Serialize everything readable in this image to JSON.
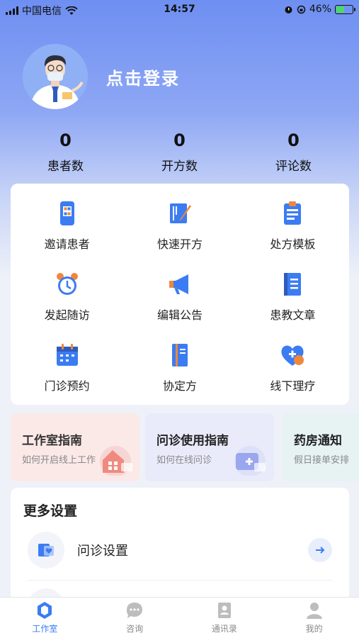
{
  "status": {
    "carrier": "中国电信",
    "time": "14:57",
    "battery": "46%",
    "battery_level": 0.46
  },
  "profile": {
    "login_text": "点击登录"
  },
  "stats": [
    {
      "value": "0",
      "label": "患者数"
    },
    {
      "value": "0",
      "label": "开方数"
    },
    {
      "value": "0",
      "label": "评论数"
    }
  ],
  "tools": [
    {
      "label": "邀请患者",
      "icon": "qr-phone-icon"
    },
    {
      "label": "快速开方",
      "icon": "prescription-pen-icon"
    },
    {
      "label": "处方模板",
      "icon": "clipboard-icon"
    },
    {
      "label": "发起随访",
      "icon": "alarm-clock-icon"
    },
    {
      "label": "编辑公告",
      "icon": "megaphone-icon"
    },
    {
      "label": "患教文章",
      "icon": "book-icon"
    },
    {
      "label": "门诊预约",
      "icon": "calendar-icon"
    },
    {
      "label": "协定方",
      "icon": "notebook-icon"
    },
    {
      "label": "线下理疗",
      "icon": "heart-plus-icon"
    }
  ],
  "guides": [
    {
      "title": "工作室指南",
      "subtitle": "如何开启线上工作"
    },
    {
      "title": "问诊使用指南",
      "subtitle": "如何在线问诊"
    },
    {
      "title": "药房通知",
      "subtitle": "假日接单安排"
    }
  ],
  "more": {
    "title": "更多设置",
    "rows": [
      {
        "label": "问诊设置"
      }
    ]
  },
  "tabs": [
    {
      "label": "工作室",
      "active": true
    },
    {
      "label": "咨询"
    },
    {
      "label": "通讯录"
    },
    {
      "label": "我的"
    }
  ],
  "colors": {
    "primary": "#3b7cf2",
    "accent_orange": "#f0873a",
    "header_blue": "#6e8ff2"
  }
}
